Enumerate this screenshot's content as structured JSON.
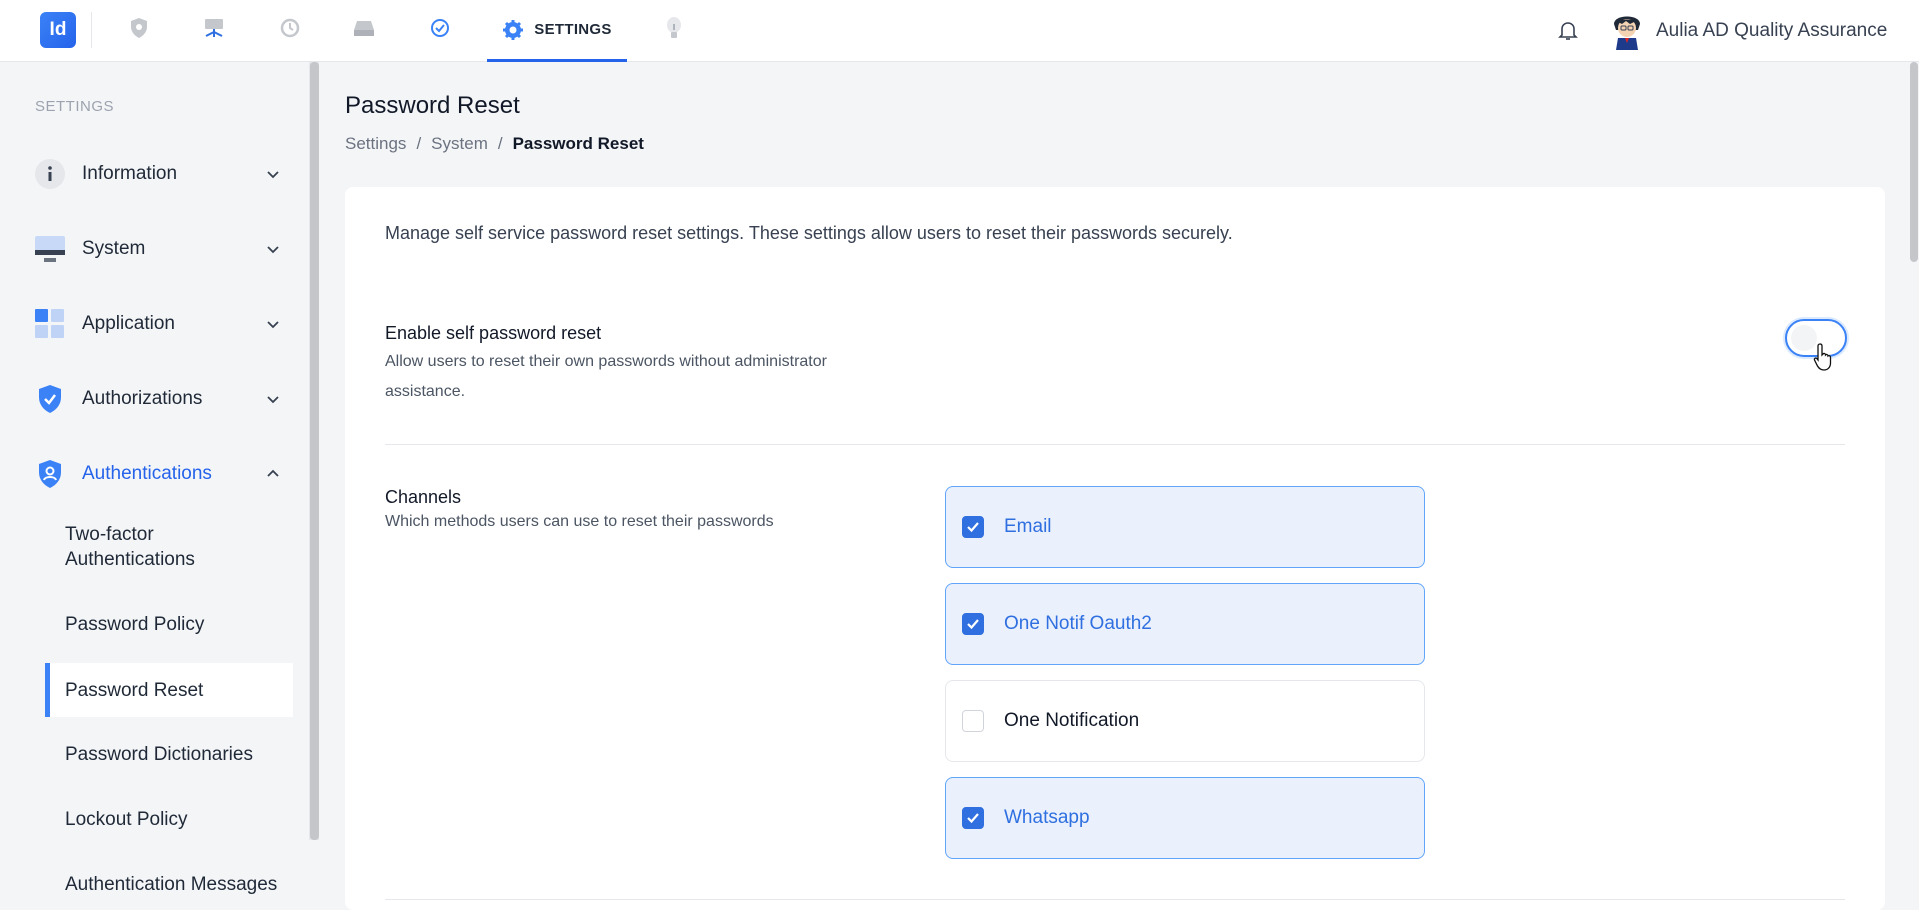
{
  "topbar": {
    "logo": "Id",
    "active_tab": "SETTINGS",
    "nav_icons": [
      "shield-icon",
      "monitor-tree-icon",
      "history-icon",
      "drive-icon",
      "check-badge-icon",
      "bulb-icon"
    ],
    "username": "Aulia AD Quality Assurance"
  },
  "sidebar": {
    "heading": "SETTINGS",
    "items": [
      {
        "label": "Information",
        "icon": "info-icon"
      },
      {
        "label": "System",
        "icon": "computer-icon"
      },
      {
        "label": "Application",
        "icon": "grid-icon"
      },
      {
        "label": "Authorizations",
        "icon": "shield-check-icon"
      },
      {
        "label": "Authentications",
        "icon": "shield-user-icon",
        "expanded": true
      }
    ],
    "subitems": [
      {
        "label": "Two-factor Authentications"
      },
      {
        "label": "Password Policy"
      },
      {
        "label": "Password Reset",
        "current": true
      },
      {
        "label": "Password Dictionaries"
      },
      {
        "label": "Lockout Policy"
      },
      {
        "label": "Authentication Messages"
      }
    ]
  },
  "page": {
    "title": "Password Reset",
    "breadcrumb": [
      "Settings",
      "/",
      "System",
      "/",
      "Password Reset"
    ],
    "description": "Manage self service password reset settings. These settings allow users to reset their passwords securely.",
    "self_reset": {
      "title": "Enable self password reset",
      "subtitle": "Allow users to reset their own passwords without administrator assistance.",
      "enabled": false
    },
    "channels": {
      "title": "Channels",
      "subtitle": "Which methods users can use to reset their passwords",
      "options": [
        {
          "label": "Email",
          "checked": true
        },
        {
          "label": "One Notif Oauth2",
          "checked": true
        },
        {
          "label": "One Notification",
          "checked": false
        },
        {
          "label": "Whatsapp",
          "checked": true
        }
      ]
    }
  },
  "colors": {
    "accent": "#2563eb",
    "selected_bg": "#eaf1fd"
  }
}
